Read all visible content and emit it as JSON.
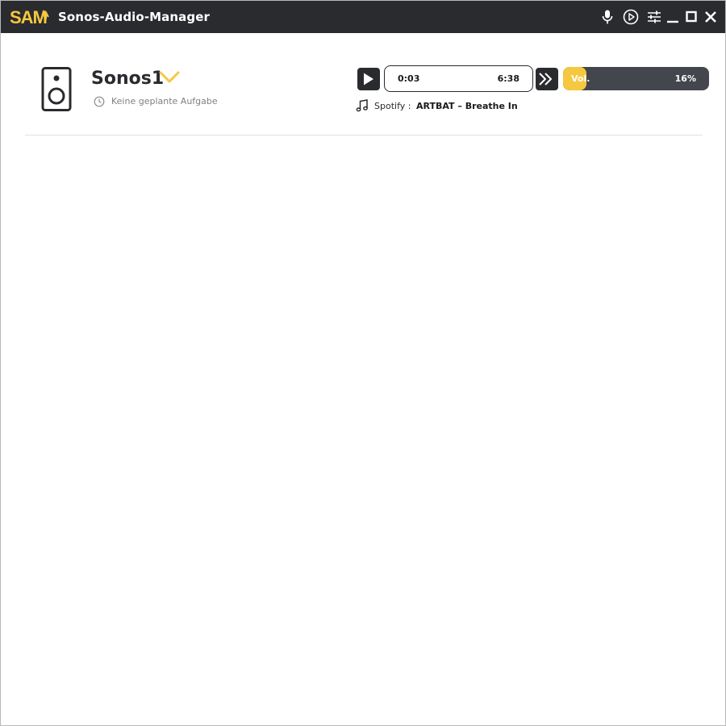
{
  "window": {
    "title": "Sonos-Audio-Manager",
    "logo_text": "SAM",
    "titlebar_icons": [
      "microphone-icon",
      "play-circle-icon",
      "sliders-icon",
      "minimize-icon",
      "maximize-icon",
      "close-icon"
    ]
  },
  "device": {
    "name": "Sonos1",
    "icon": "speaker-icon",
    "schedule_text": "Keine geplante Aufgabe"
  },
  "player": {
    "elapsed": "0:03",
    "duration": "6:38",
    "volume_label": "Vol.",
    "volume_percent": 16,
    "volume_text": "16%",
    "source_label": "Spotify :",
    "track": "ARTBAT – Breathe In"
  },
  "colors": {
    "accent": "#f5c83f",
    "titlebar": "#2a2b2f",
    "slider_track": "#44464d"
  }
}
